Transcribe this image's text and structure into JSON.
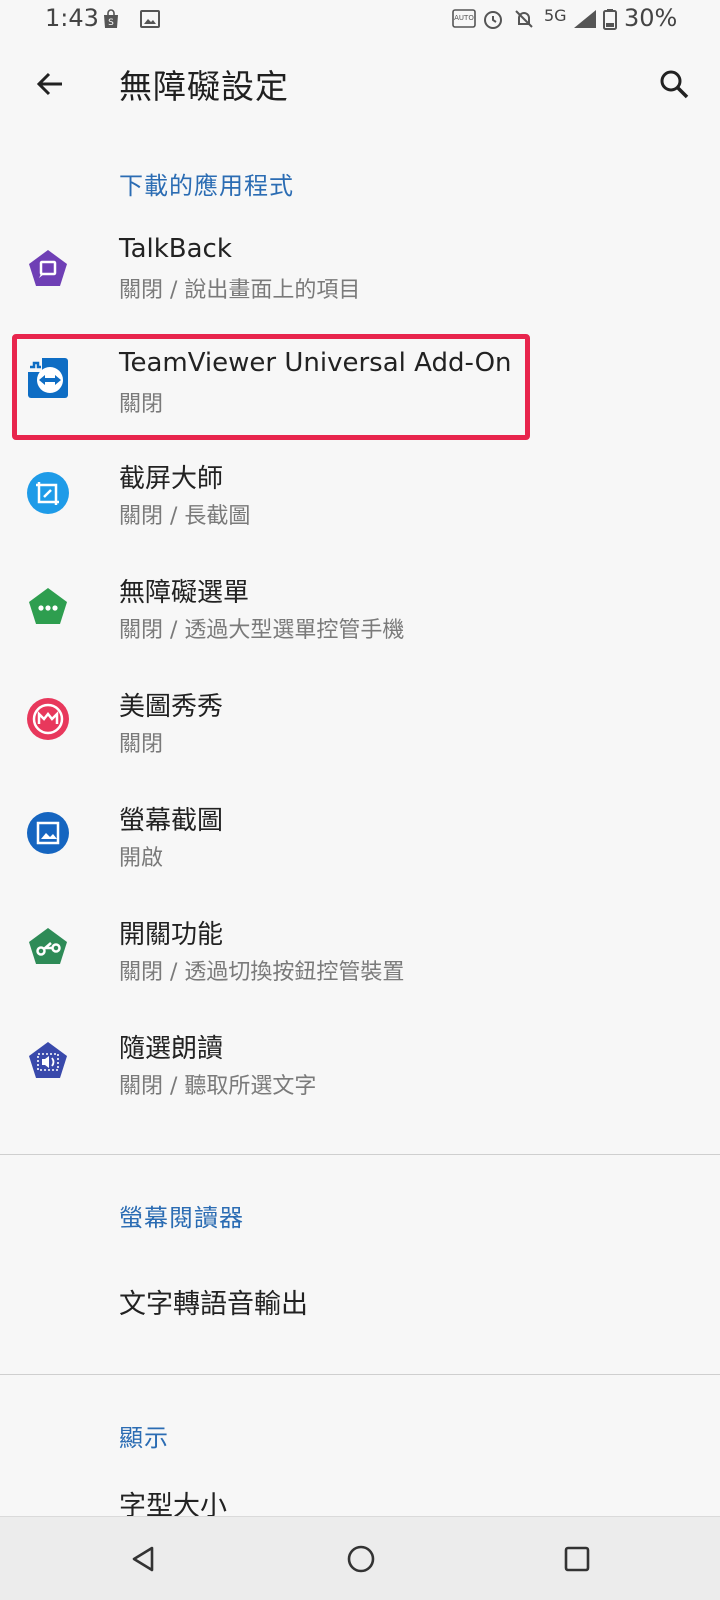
{
  "status_bar": {
    "time": "1:43",
    "network": "5G",
    "battery": "30%",
    "icons": [
      "store-icon",
      "image-icon",
      "auto-hz-icon",
      "alarm-icon",
      "notifications-off-icon",
      "signal-icon",
      "battery-icon"
    ]
  },
  "toolbar": {
    "title": "無障礙設定",
    "back_icon": "arrow-back-icon",
    "search_icon": "search-icon"
  },
  "sections": {
    "downloaded_apps": "下載的應用程式",
    "screen_readers": "螢幕閱讀器",
    "display": "顯示"
  },
  "apps": [
    {
      "title": "TalkBack",
      "summary": "關閉 / 說出畫面上的項目",
      "icon": "talkback-icon",
      "color": "#6f3fb5"
    },
    {
      "title": "TeamViewer Universal Add-On",
      "summary": "關閉",
      "icon": "teamviewer-icon",
      "color": "#0e6dc4"
    },
    {
      "title": "截屏大師",
      "summary": "關閉 / 長截圖",
      "icon": "screenshot-master-icon",
      "color": "#1e9be8"
    },
    {
      "title": "無障礙選單",
      "summary": "關閉 / 透過大型選單控管手機",
      "icon": "accessibility-menu-icon",
      "color": "#2e9e4f"
    },
    {
      "title": "美圖秀秀",
      "summary": "關閉",
      "icon": "meitu-icon",
      "color": "#e8385c"
    },
    {
      "title": "螢幕截圖",
      "summary": "開啟",
      "icon": "screen-capture-icon",
      "color": "#1565c0"
    },
    {
      "title": "開關功能",
      "summary": "關閉 / 透過切換按鈕控管裝置",
      "icon": "switch-access-icon",
      "color": "#2e8b57"
    },
    {
      "title": "隨選朗讀",
      "summary": "關閉 / 聽取所選文字",
      "icon": "select-to-speak-icon",
      "color": "#3949ab"
    }
  ],
  "screen_reader_items": [
    "文字轉語音輸出"
  ],
  "display_items": [
    "字型大小"
  ],
  "highlight_color": "#e8254d",
  "accent_color": "#2b6cb3",
  "nav": {
    "back": "nav-back-icon",
    "home": "nav-home-icon",
    "recents": "nav-recents-icon"
  }
}
